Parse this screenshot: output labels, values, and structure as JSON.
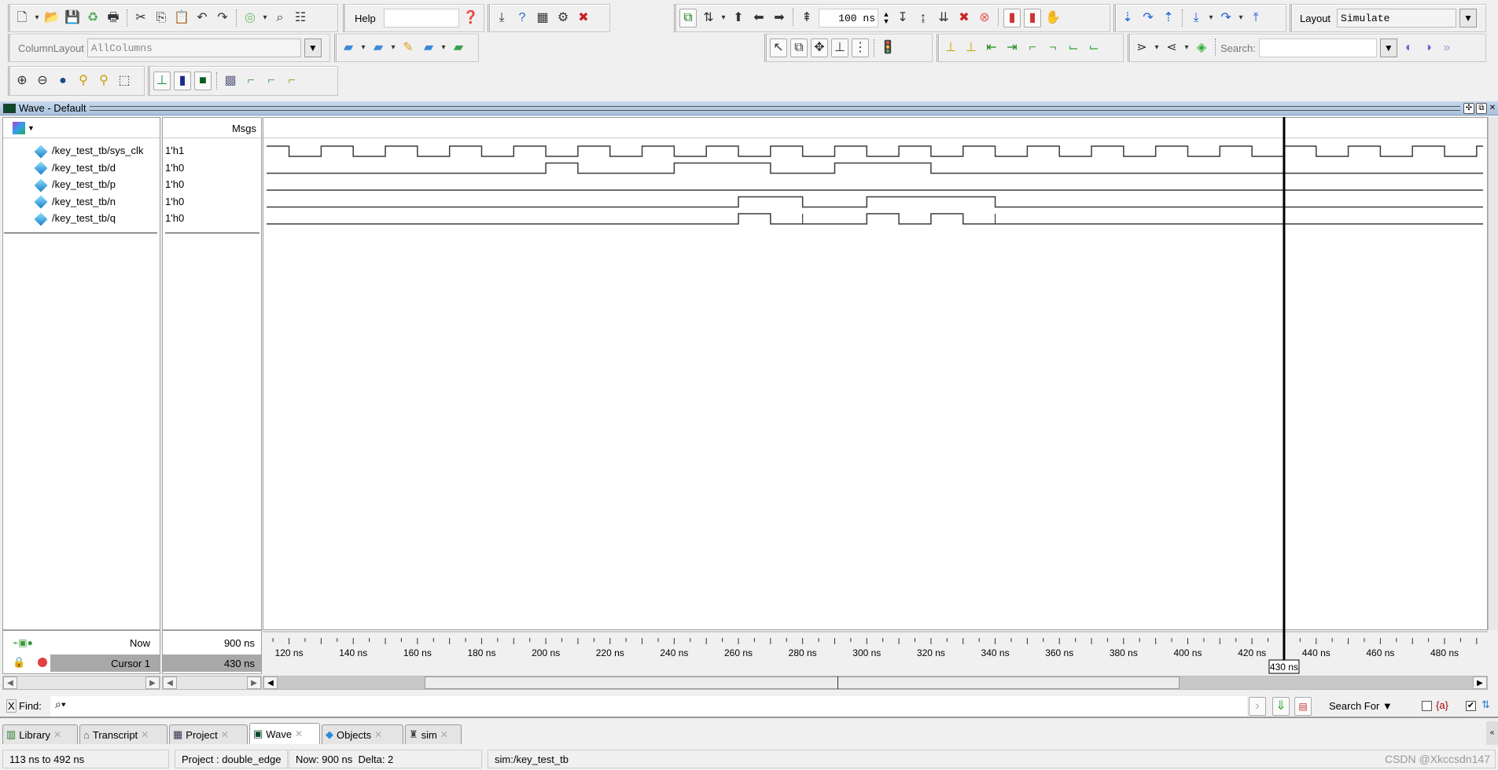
{
  "toolbar": {
    "row1_group1": [
      "new-file-icon",
      "dropdown-arrow-icon",
      "open-folder-icon",
      "save-icon",
      "refresh-icon",
      "print-icon",
      "|",
      "cut-icon",
      "copy-icon",
      "paste-icon",
      "undo-icon",
      "redo-icon",
      "|",
      "compile-icon",
      "dropdown-arrow-icon",
      "find-icon",
      "column-icon"
    ],
    "help_label": "Help",
    "help_value": "",
    "help_search_icon": "help-search-icon",
    "row1_group3": [
      "load-icon",
      "help-book-icon",
      "memory-icon",
      "dataflow-icon",
      "break-icon"
    ],
    "row1_group4": [
      "link-icon",
      "sort-icon",
      "dropdown-arrow-icon",
      "up-arrow-icon",
      "left-arrow-icon",
      "right-arrow-icon",
      "|",
      "run-length-icon"
    ],
    "run_length": "100 ns",
    "row1_group4b": [
      "run-icon",
      "continue-icon",
      "run-all-icon",
      "stop-icon",
      "restart-icon",
      "|",
      "performance-icon",
      "memory-profile-icon",
      "hand-icon"
    ],
    "row1_group5": [
      "step-icon",
      "step-over-icon",
      "step-out-icon",
      "|",
      "step-into-icon",
      "dropdown-arrow-icon",
      "step-over-all-icon",
      "dropdown-arrow-icon",
      "step-back-icon"
    ],
    "layout_label": "Layout",
    "layout_value": "Simulate",
    "column_layout_label": "ColumnLayout",
    "column_layout_value": "AllColumns",
    "row2_group2": [
      "add-wave-icon",
      "dropdown-arrow-icon",
      "remove-wave-icon",
      "dropdown-arrow-icon",
      "edit-wave-icon",
      "save-wave-icon",
      "dropdown-arrow-icon",
      "export-wave-icon"
    ],
    "row2_group3": [
      "select-pointer-icon",
      "zoom-mode-icon",
      "pan-icon",
      "cursor-mode-icon",
      "divider-icon",
      "|",
      "traffic-light-icon"
    ],
    "row2_group4": [
      "insert-cursor-icon",
      "delete-cursor-icon",
      "prev-edge-icon",
      "next-edge-icon",
      "prev-falling-icon",
      "next-falling-icon",
      "prev-rising-icon",
      "next-rising-icon"
    ],
    "row2_group5": [
      "expand-icon",
      "dropdown-arrow-icon",
      "collapse-icon",
      "dropdown-arrow-icon",
      "trace-icon",
      "|"
    ],
    "search_label": "Search:",
    "search_value": "",
    "row2_group5b": [
      "search-prev-icon",
      "search-next-icon",
      "search-options-icon"
    ],
    "row3_group1": [
      "zoom-in-icon",
      "zoom-out-icon",
      "zoom-full-icon",
      "zoom-cursor-icon",
      "zoom-between-cursors-icon",
      "zoom-region-icon"
    ],
    "row3_group2": [
      "wave-line-icon",
      "wave-bar-icon",
      "wave-block-icon",
      "|",
      "wave-pattern-icon",
      "wave-dotted-icon",
      "wave-dashed-icon",
      "wave-step-icon"
    ]
  },
  "wave_window": {
    "title": "Wave - Default",
    "msgs_header": "Msgs",
    "signals": [
      {
        "name": "/key_test_tb/sys_clk",
        "value": "1'h1",
        "initial": 1,
        "edges": [
          120,
          130,
          140,
          150,
          160,
          170,
          180,
          190,
          200,
          210,
          220,
          230,
          240,
          250,
          260,
          270,
          280,
          290,
          300,
          310,
          320,
          330,
          340,
          350,
          360,
          370,
          380,
          390,
          400,
          410,
          420,
          430,
          440,
          450,
          460,
          470,
          480,
          490
        ],
        "glitches": []
      },
      {
        "name": "/key_test_tb/d",
        "value": "1'h0",
        "initial": 0,
        "edges": [
          200,
          210,
          240,
          270,
          290,
          320
        ],
        "glitches": []
      },
      {
        "name": "/key_test_tb/p",
        "value": "1'h0",
        "initial": 0,
        "edges": [],
        "glitches": []
      },
      {
        "name": "/key_test_tb/n",
        "value": "1'h0",
        "initial": 0,
        "edges": [
          260,
          280,
          300,
          340
        ],
        "glitches": []
      },
      {
        "name": "/key_test_tb/q",
        "value": "1'h0",
        "initial": 0,
        "edges": [
          260,
          270,
          300,
          310,
          320,
          330
        ],
        "glitches": [
          280,
          340
        ]
      }
    ],
    "time_range": {
      "start": 113,
      "end": 492,
      "unit": "ns"
    },
    "tick_labels": [
      "120 ns",
      "140 ns",
      "160 ns",
      "180 ns",
      "200 ns",
      "220 ns",
      "240 ns",
      "260 ns",
      "280 ns",
      "300 ns",
      "320 ns",
      "340 ns",
      "360 ns",
      "380 ns",
      "400 ns",
      "420 ns",
      "440 ns",
      "460 ns",
      "480 ns"
    ],
    "now_label": "Now",
    "now_value": "900 ns",
    "cursor_label": "Cursor 1",
    "cursor_value": "430 ns",
    "cursor_time": 430,
    "cursor_flag": "430 ns"
  },
  "find_bar": {
    "close": "X",
    "label": "Find:",
    "search_for": "Search For",
    "regex_label": "{a}",
    "regex_checked": false,
    "option_checked": true
  },
  "tabs": [
    {
      "label": "Library",
      "icon": "library-icon"
    },
    {
      "label": "Transcript",
      "icon": "transcript-icon"
    },
    {
      "label": "Project",
      "icon": "project-icon"
    },
    {
      "label": "Wave",
      "icon": "wave-icon",
      "active": true
    },
    {
      "label": "Objects",
      "icon": "objects-icon"
    },
    {
      "label": "sim",
      "icon": "sim-icon"
    }
  ],
  "status_bar": {
    "range": "113 ns to 492 ns",
    "project": "Project : double_edge",
    "now": "Now: 900 ns  Delta: 2",
    "context": "sim:/key_test_tb",
    "watermark": "CSDN @Xkccsdn147"
  },
  "colors": {
    "wave": "#3c3c3c",
    "cursor": "#000000",
    "titlebar": "#b8cde6",
    "signal_icon": "#1a7fc8"
  }
}
